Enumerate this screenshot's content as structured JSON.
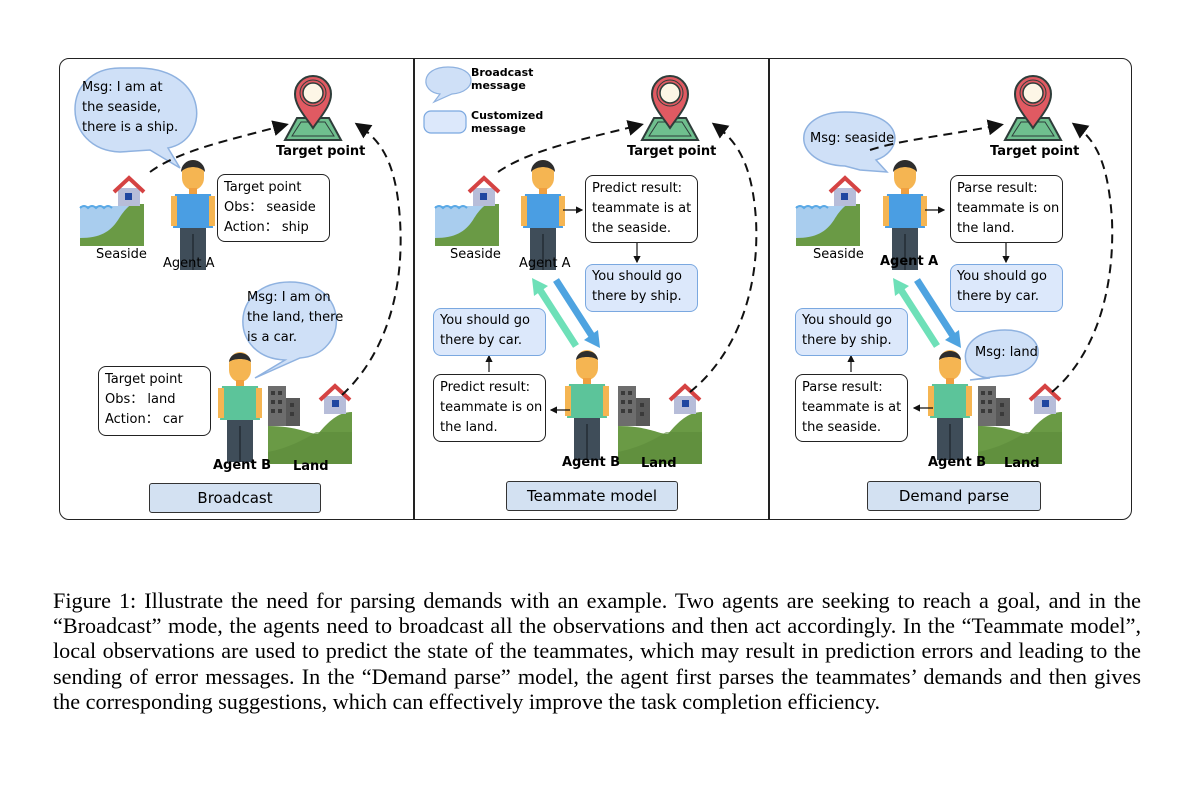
{
  "legend": {
    "broadcast": "Broadcast message",
    "broadcast_l1": "Broadcast",
    "broadcast_l2": "message",
    "customized_l1": "Customized",
    "customized_l2": "message"
  },
  "panels": [
    {
      "mode": "Broadcast",
      "target_label": "Target point",
      "seaside_label": "Seaside",
      "land_label": "Land",
      "agent_a_label": "Agent A",
      "agent_b_label": "Agent B",
      "agent_a_msg": [
        "Msg: I am at",
        "the seaside,",
        "there is a ship."
      ],
      "agent_b_msg": [
        "Msg: I am on",
        "the land, there",
        "is a car."
      ],
      "agent_a_box": [
        "Target point",
        "Obs： seaside",
        "Action： ship"
      ],
      "agent_b_box": [
        "Target point",
        "Obs： land",
        "Action： car"
      ]
    },
    {
      "mode": "Teammate model",
      "target_label": "Target point",
      "seaside_label": "Seaside",
      "land_label": "Land",
      "agent_a_label": "Agent A",
      "agent_b_label": "Agent B",
      "agent_a_result": [
        "Predict result:",
        "teammate is at",
        "the seaside."
      ],
      "agent_a_advice": [
        "You should go",
        "there by ship."
      ],
      "agent_b_result": [
        "Predict result:",
        "teammate is on",
        "the land."
      ],
      "agent_b_advice": [
        "You should go",
        "there by car."
      ]
    },
    {
      "mode": "Demand parse",
      "target_label": "Target point",
      "seaside_label": "Seaside",
      "land_label": "Land",
      "agent_a_label": "Agent A",
      "agent_b_label": "Agent B",
      "agent_a_msg": "Msg: seaside",
      "agent_b_msg": "Msg: land",
      "agent_a_result": [
        "Parse result:",
        "teammate is on",
        "the land."
      ],
      "agent_a_advice": [
        "You should go",
        "there by car."
      ],
      "agent_b_result": [
        "Parse result:",
        "teammate is at",
        "the seaside."
      ],
      "agent_b_advice": [
        "You should go",
        "there by ship."
      ]
    }
  ],
  "colors": {
    "bubble_fill": "#cfe0f7",
    "bubble_stroke": "#8fb2e0",
    "custom_fill": "#dce8fb",
    "mode_fill": "#d3e1f2",
    "pin_red": "#e05a62",
    "map_green": "#6fbf8e",
    "grass_green": "#6a9a45",
    "water_blue": "#a9cdee",
    "agent_a_shirt": "#4a9ee3",
    "agent_b_shirt": "#5cc49a",
    "arrow_teal": "#6ee0b8",
    "arrow_blue": "#4ea3e0"
  },
  "caption": "Figure 1: Illustrate the need for parsing demands with an example. Two agents are seeking to reach a goal, and in the “Broadcast” mode, the agents need to broadcast all the observations and then act accordingly. In the “Teammate model”, local observations are used to predict the state of the teammates, which may result in prediction errors and leading to the sending of error messages. In the “Demand parse” model, the agent first parses the teammates’ demands and then gives the corresponding suggestions, which can effectively improve the task completion efficiency."
}
